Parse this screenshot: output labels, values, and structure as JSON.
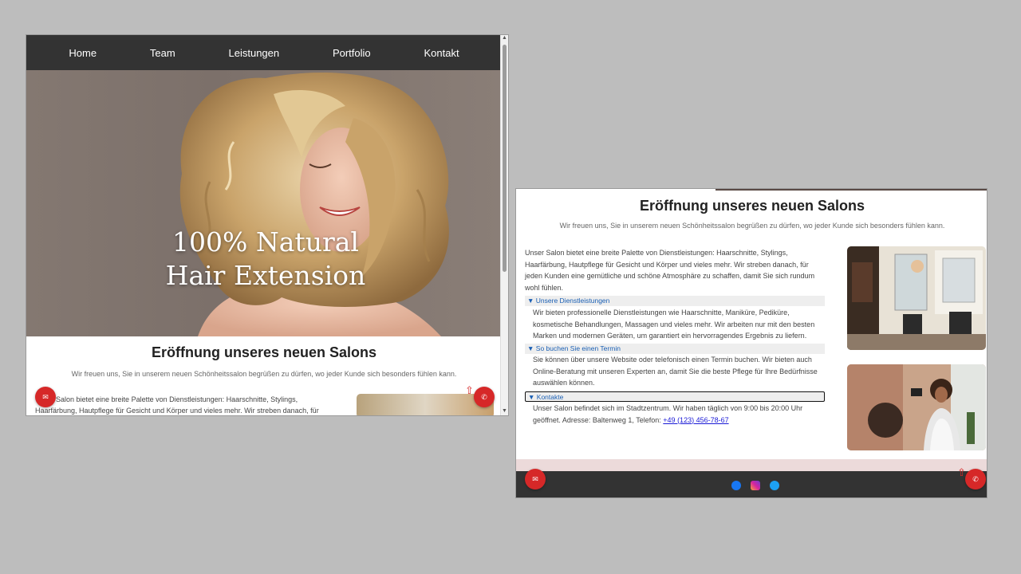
{
  "nav": {
    "items": [
      "Home",
      "Team",
      "Leistungen",
      "Portfolio",
      "Kontakt"
    ]
  },
  "hero": {
    "title_line1": "100% Natural",
    "title_line2": "Hair Extension"
  },
  "intro": {
    "title": "Eröffnung unseres neuen Salons",
    "subtitle": "Wir freuen uns, Sie in unserem neuen Schönheitssalon begrüßen zu dürfen, wo jeder Kunde sich besonders fühlen kann.",
    "paragraph": "Unser Salon bietet eine breite Palette von Dienstleistungen: Haarschnitte, Stylings, Haarfärbung, Hautpflege für Gesicht und Körper und vieles mehr. Wir streben danach, für jeden Kunden eine gemütliche und schöne Atmosphäre zu schaffen, damit Sie sich rundum wohl fühlen.",
    "paragraph_partial": "Salon bietet eine breite Palette von Dienstleistungen: Haarschnitte, Stylings, Haarfärbung, Hautpflege für Gesicht und Körper und vieles mehr. Wir streben danach, für"
  },
  "details": [
    {
      "summary": "▼ Unsere Dienstleistungen",
      "body": "Wir bieten professionelle Dienstleistungen wie Haarschnitte, Maniküre, Pediküre, kosmetische Behandlungen, Massagen und vieles mehr. Wir arbeiten nur mit den besten Marken und modernen Geräten, um garantiert ein hervorragendes Ergebnis zu liefern."
    },
    {
      "summary": "▼ So buchen Sie einen Termin",
      "body": "Sie können über unsere Website oder telefonisch einen Termin buchen. Wir bieten auch Online-Beratung mit unseren Experten an, damit Sie die beste Pflege für Ihre Bedürfnisse auswählen können."
    },
    {
      "summary": "▼ Kontakte",
      "body": "Unser Salon befindet sich im Stadtzentrum. Wir haben täglich von 9:00 bis 20:00 Uhr geöffnet. Adresse: Baltenweg 1, Telefon: ",
      "phone": "+49 (123) 456-78-67"
    }
  ],
  "icons": {
    "email": "✉",
    "phone": "✆",
    "up": "⇧"
  },
  "colors": {
    "accent": "#d62828",
    "nav_bg": "#333333",
    "link": "#1a5fb4"
  }
}
